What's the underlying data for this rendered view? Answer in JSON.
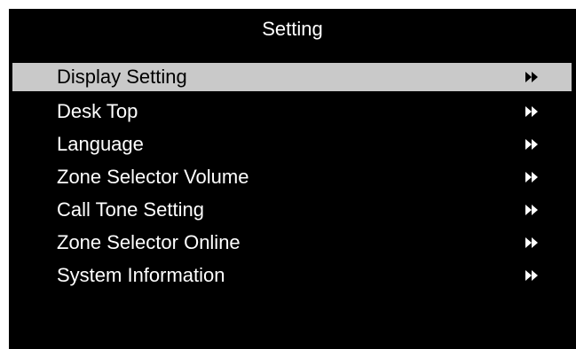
{
  "header": {
    "title": "Setting"
  },
  "menu": {
    "items": [
      {
        "label": "Display Setting",
        "selected": true
      },
      {
        "label": "Desk Top",
        "selected": false
      },
      {
        "label": "Language",
        "selected": false
      },
      {
        "label": "Zone Selector Volume",
        "selected": false
      },
      {
        "label": "Call Tone Setting",
        "selected": false
      },
      {
        "label": "Zone Selector Online",
        "selected": false
      },
      {
        "label": "System Information",
        "selected": false
      }
    ],
    "arrow_icon": "double-chevron-right-icon"
  },
  "colors": {
    "background": "#000000",
    "text": "#ffffff",
    "selected_background": "#c9c9c9",
    "selected_text": "#000000"
  }
}
